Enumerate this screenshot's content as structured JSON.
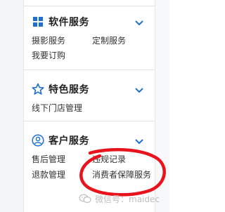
{
  "sections": [
    {
      "title": "软件服务",
      "icon": "grid-icon",
      "links": [
        "摄影服务",
        "定制服务",
        "我要订购"
      ]
    },
    {
      "title": "特色服务",
      "icon": "star-icon",
      "links": [
        "线下门店管理"
      ]
    },
    {
      "title": "客户服务",
      "icon": "user-circle-icon",
      "links": [
        "售后管理",
        "违规记录",
        "退款管理",
        "消费者保障服务"
      ]
    }
  ],
  "watermark": {
    "text": "微信号：maidec",
    "icon": "wechat-icon"
  },
  "colors": {
    "accent": "#1d6fd1",
    "annotation": "#e8131d",
    "text": "#333333"
  }
}
